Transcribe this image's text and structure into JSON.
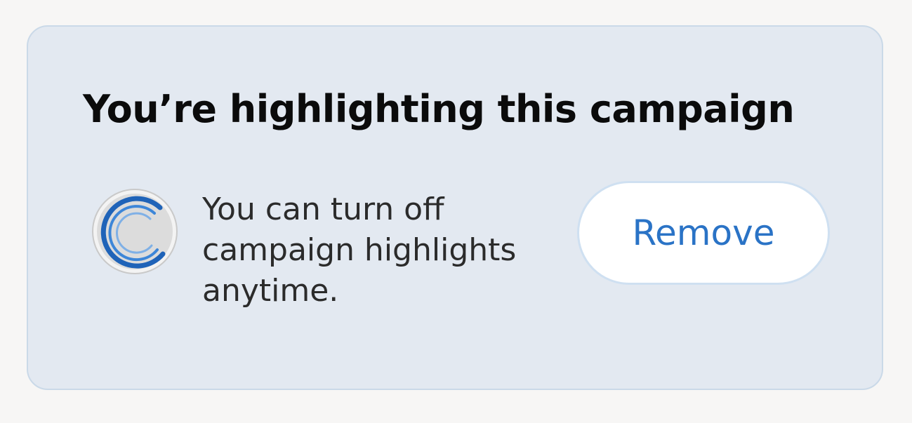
{
  "banner": {
    "title": "You’re highlighting this campaign",
    "description": "You can turn off campaign highlights anytime.",
    "icon": "loading-spinner-icon",
    "remove_label": "Remove"
  },
  "colors": {
    "card_background": "#e3e9f1",
    "accent": "#2a73c6",
    "title_text": "#0b0b0b"
  }
}
